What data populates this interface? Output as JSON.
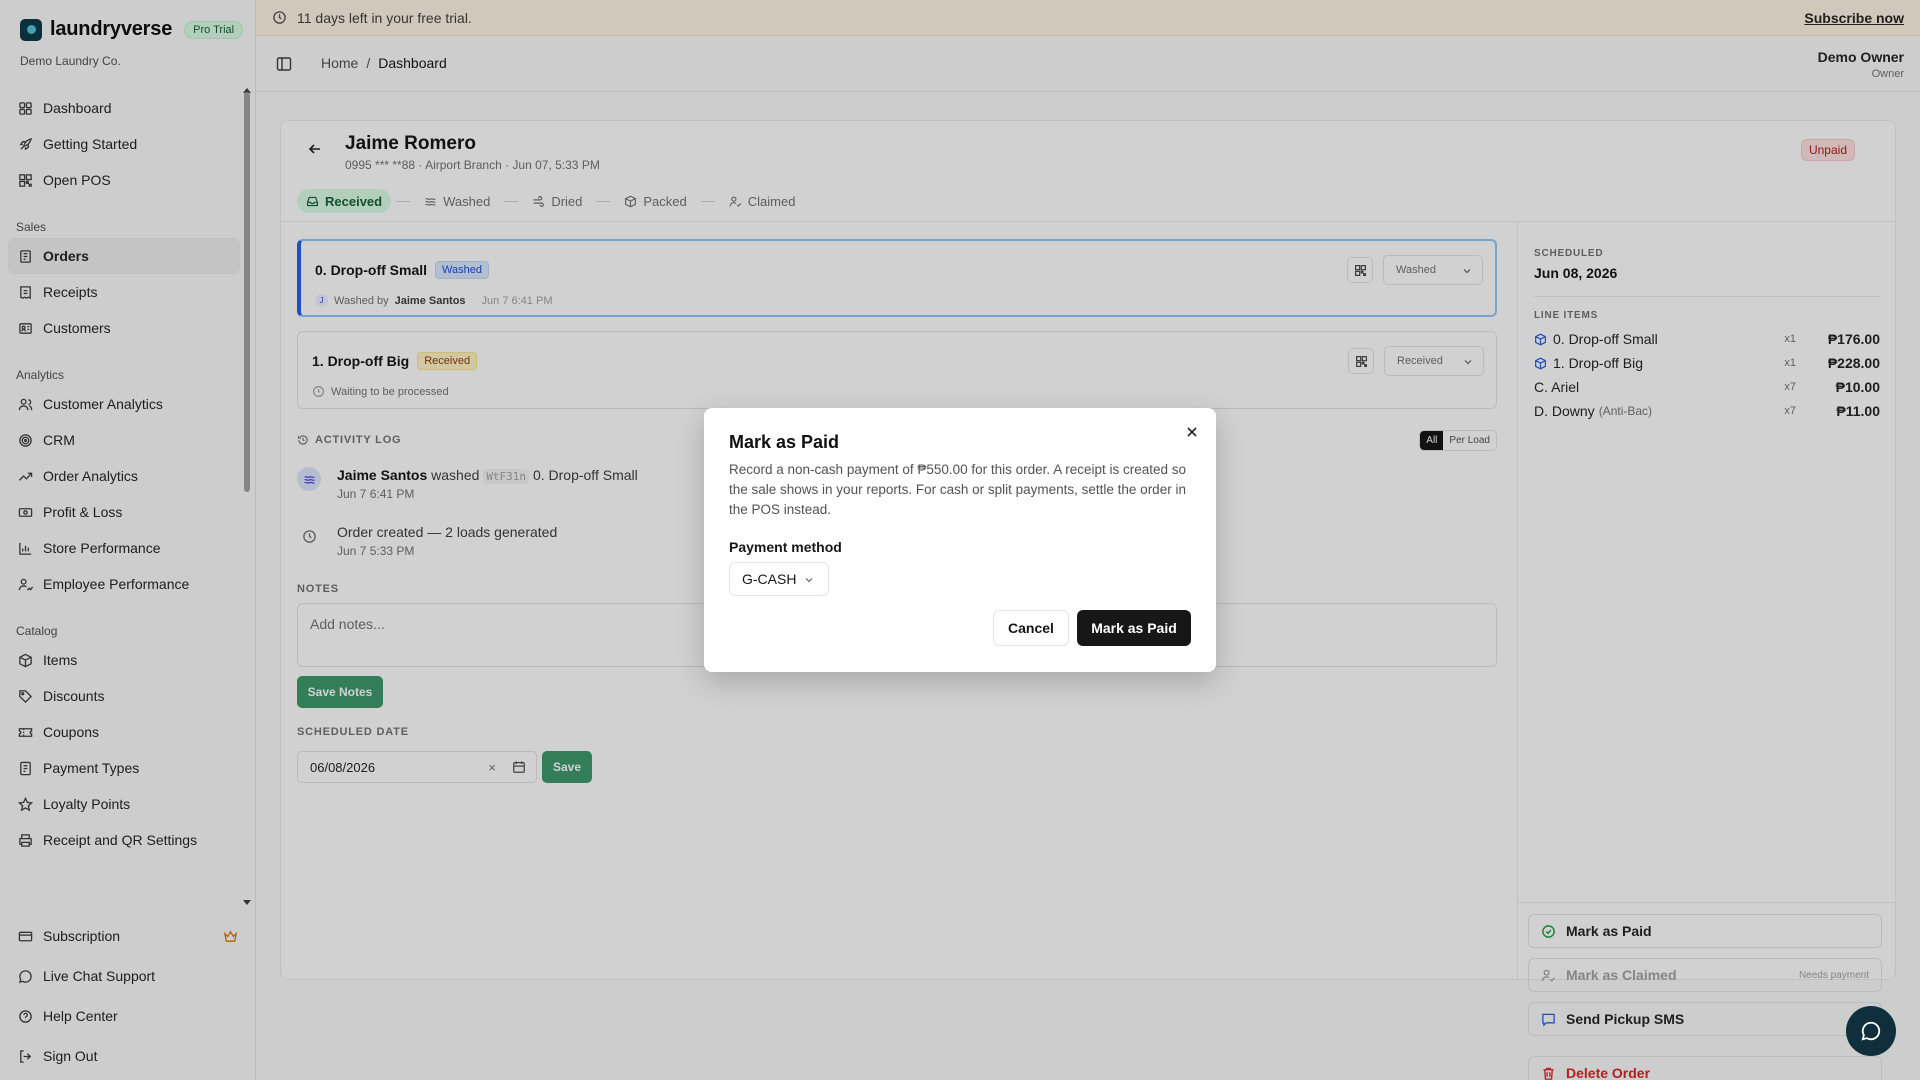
{
  "brand": {
    "name": "laundryverse",
    "badge": "Pro Trial",
    "org": "Demo Laundry Co."
  },
  "trial": {
    "text": "11 days left in your free trial.",
    "cta": "Subscribe now"
  },
  "breadcrumb": {
    "home": "Home",
    "sep": "/",
    "current": "Dashboard"
  },
  "user": {
    "name": "Demo Owner",
    "role": "Owner"
  },
  "nav": {
    "main": [
      {
        "label": "Dashboard",
        "icon": "dashboard-icon"
      },
      {
        "label": "Getting Started",
        "icon": "rocket-icon"
      },
      {
        "label": "Open POS",
        "icon": "pos-icon"
      }
    ],
    "sales_label": "Sales",
    "sales": [
      {
        "label": "Orders",
        "icon": "orders-icon"
      },
      {
        "label": "Receipts",
        "icon": "receipt-icon"
      },
      {
        "label": "Customers",
        "icon": "customers-icon"
      }
    ],
    "analytics_label": "Analytics",
    "analytics": [
      {
        "label": "Customer Analytics",
        "icon": "users-icon"
      },
      {
        "label": "CRM",
        "icon": "target-icon"
      },
      {
        "label": "Order Analytics",
        "icon": "trend-icon"
      },
      {
        "label": "Profit & Loss",
        "icon": "money-icon"
      },
      {
        "label": "Store Performance",
        "icon": "bar-chart-icon"
      },
      {
        "label": "Employee Performance",
        "icon": "user-chart-icon"
      }
    ],
    "catalog_label": "Catalog",
    "catalog": [
      {
        "label": "Items",
        "icon": "box-icon"
      },
      {
        "label": "Discounts",
        "icon": "tag-icon"
      },
      {
        "label": "Coupons",
        "icon": "ticket-icon"
      },
      {
        "label": "Payment Types",
        "icon": "card-icon"
      },
      {
        "label": "Loyalty Points",
        "icon": "star-icon"
      },
      {
        "label": "Receipt and QR Settings",
        "icon": "printer-icon"
      }
    ],
    "bottom": [
      {
        "label": "Subscription",
        "icon": "subscription-icon"
      },
      {
        "label": "Live Chat Support",
        "icon": "chat-icon"
      },
      {
        "label": "Help Center",
        "icon": "help-icon"
      },
      {
        "label": "Sign Out",
        "icon": "sign-out-icon"
      }
    ]
  },
  "order": {
    "customer": "Jaime Romero",
    "subtitle": "0995 *** **88 · Airport Branch · Jun 07, 5:33 PM",
    "payment_status": "Unpaid",
    "steps": [
      "Received",
      "Washed",
      "Dried",
      "Packed",
      "Claimed"
    ],
    "loads": [
      {
        "title": "0. Drop-off Small",
        "tag": "Washed",
        "meta_avatar": "J",
        "meta_prefix": "Washed by",
        "meta_name": "Jaime Santos",
        "meta_time": "Jun 7 6:41 PM",
        "status": "Washed"
      },
      {
        "title": "1. Drop-off Big",
        "tag": "Received",
        "meta_text": "Waiting to be processed",
        "status": "Received"
      }
    ],
    "activity_label": "ACTIVITY LOG",
    "activity_toggle": [
      "All",
      "Per Load"
    ],
    "activity": [
      {
        "actor": "Jaime Santos",
        "verb": "washed",
        "code": "WtF31n",
        "target": "0. Drop-off Small",
        "time": "Jun 7 6:41 PM"
      },
      {
        "text": "Order created — 2 loads generated",
        "time": "Jun 7 5:33 PM"
      }
    ],
    "notes_label": "NOTES",
    "notes_placeholder": "Add notes...",
    "save_notes": "Save Notes",
    "scheduled_label": "SCHEDULED DATE",
    "scheduled_value": "06/08/2026",
    "clear_glyph": "×",
    "save": "Save"
  },
  "summary": {
    "scheduled_label": "SCHEDULED",
    "scheduled_date": "Jun 08, 2026",
    "line_items_label": "LINE ITEMS",
    "items": [
      {
        "name": "0. Drop-off Small",
        "qty": "x1",
        "price": "₱176.00"
      },
      {
        "name": "1. Drop-off Big",
        "qty": "x1",
        "price": "₱228.00"
      },
      {
        "name": "C. Ariel",
        "qty": "x7",
        "price": "₱10.00"
      },
      {
        "name": "D. Downy",
        "extra": "(Anti-Bac)",
        "qty": "x7",
        "price": "₱11.00"
      }
    ],
    "actions": {
      "mark_paid": "Mark as Paid",
      "mark_claimed": "Mark as Claimed",
      "claimed_hint": "Needs payment",
      "send_sms": "Send Pickup SMS",
      "delete": "Delete Order"
    }
  },
  "modal": {
    "title": "Mark as Paid",
    "description": "Record a non-cash payment of ₱550.00 for this order. A receipt is created so the sale shows in your reports. For cash or split payments, settle the order in the POS instead.",
    "method_label": "Payment method",
    "method_value": "G-CASH",
    "cancel": "Cancel",
    "confirm": "Mark as Paid"
  }
}
